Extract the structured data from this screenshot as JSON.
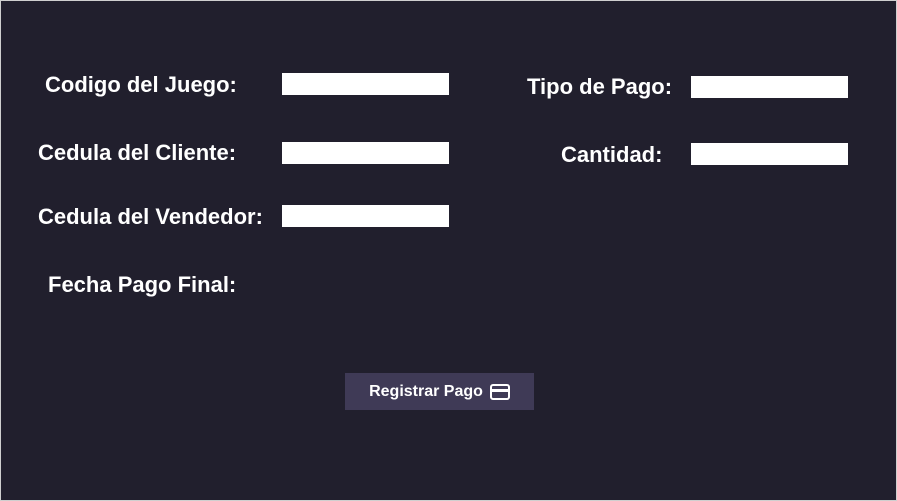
{
  "form": {
    "codigo_juego_label": "Codigo del Juego:",
    "cedula_cliente_label": "Cedula del Cliente:",
    "cedula_vendedor_label": "Cedula del Vendedor:",
    "fecha_pago_final_label": "Fecha Pago Final:",
    "tipo_pago_label": "Tipo de Pago:",
    "cantidad_label": "Cantidad:",
    "codigo_juego_value": "",
    "cedula_cliente_value": "",
    "cedula_vendedor_value": "",
    "tipo_pago_value": "",
    "cantidad_value": ""
  },
  "actions": {
    "registrar_pago_label": "Registrar Pago",
    "registrar_pago_icon": "credit-card-icon"
  },
  "colors": {
    "background": "#211f2d",
    "button": "#3f3a56",
    "text": "#ffffff",
    "field": "#ffffff"
  }
}
